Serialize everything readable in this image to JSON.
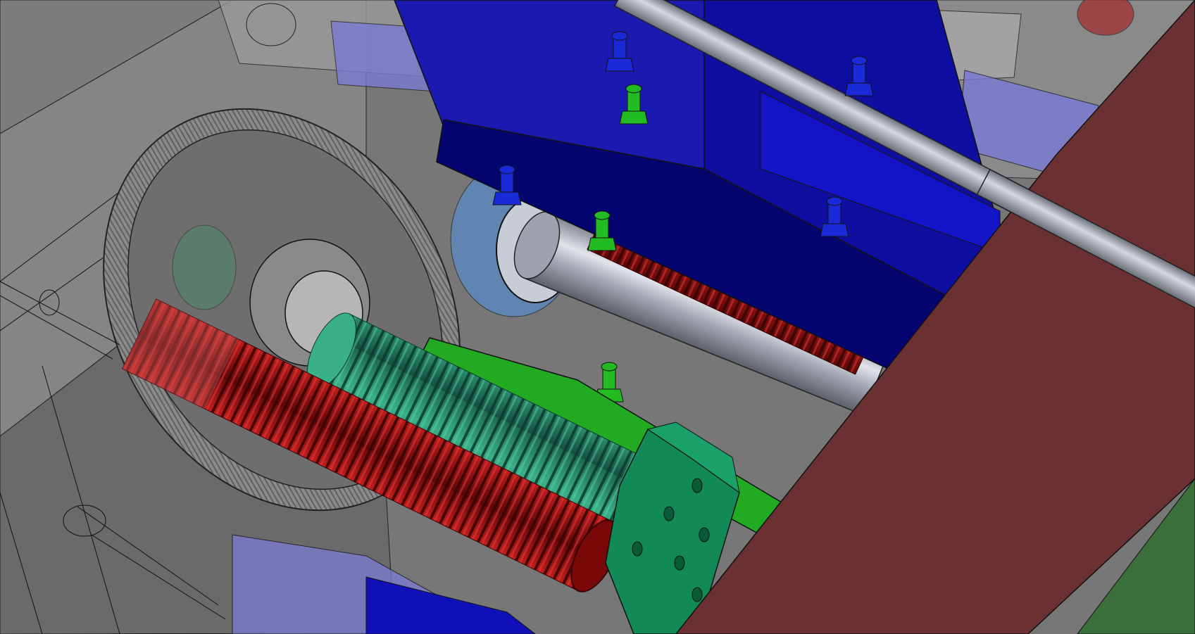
{
  "viewport": {
    "kind": "3D CAD assembly view",
    "text_labels": [],
    "background_color": "#7a7a7a",
    "colors": {
      "housing_gray": "#7c7c7c",
      "housing_dark": "#6a6a6a",
      "blue_beam": "#0a0a8c",
      "blue_beam_dark": "#050570",
      "light_blue_ghost": "#7a7ad2",
      "maroon_plate": "#6b3132",
      "green_plate": "#3a6e3a",
      "red_spring": "#b01616",
      "teal_worm": "#2a8c6a",
      "green_bracket": "#1a8a5a",
      "green_bar": "#22aa22",
      "steel_shaft": "#a8acb8"
    },
    "parts": [
      "housing",
      "gear-wheel",
      "helical-spring",
      "worm-thread",
      "blue-beam",
      "steel-shaft",
      "guide-rod",
      "maroon-plate",
      "green-bracket",
      "grease-nipple",
      "bearing",
      "lower-blue-beam",
      "green-bar"
    ]
  }
}
